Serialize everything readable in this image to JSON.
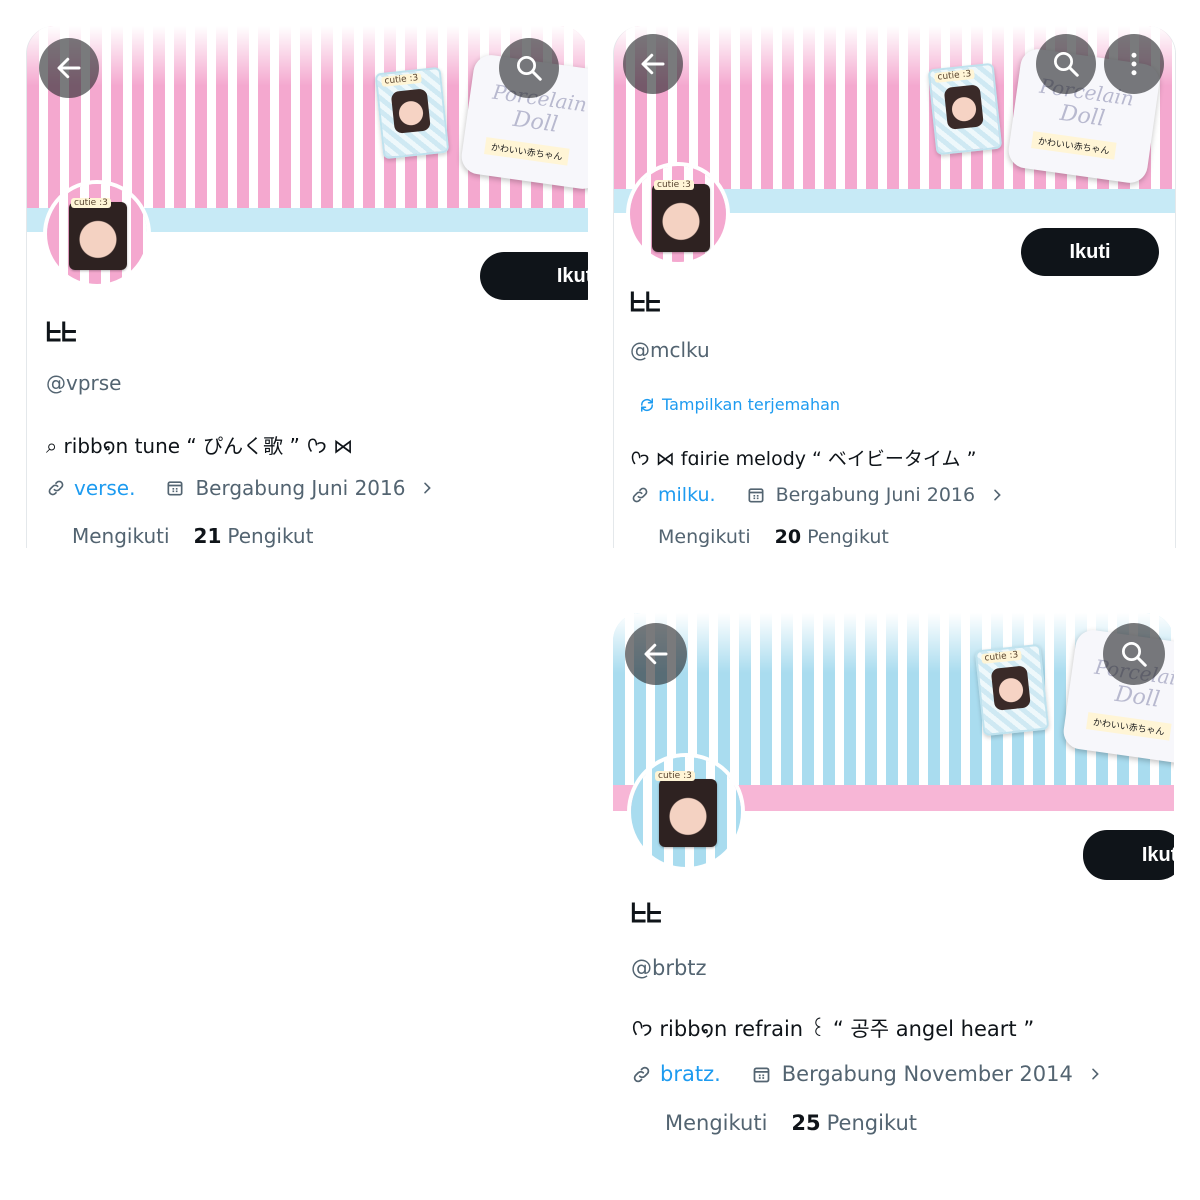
{
  "colors": {
    "accent": "#1d9bf0",
    "button_bg": "#0f1419",
    "muted": "#536471",
    "stripe_pink": "#f4a8cf",
    "stripe_blue": "#a9dcef"
  },
  "icons": {
    "back": "arrow-left-icon",
    "search": "search-icon",
    "more": "more-vertical-icon",
    "link": "link-icon",
    "calendar": "calendar-icon",
    "chevron": "chevron-right-icon",
    "translate": "translate-icon"
  },
  "banner_deco": {
    "photo_tag": "cutie :3",
    "card_line1": "Porcelain",
    "card_line2": "Doll",
    "card_tag": "かわいい赤ちゃん"
  },
  "profiles": [
    {
      "banner_theme": "pink-stripes",
      "display_name": "ᖶᖶ",
      "handle": "@vprse",
      "bio": "⌕ ribb໑n tune “ ぴんく歌 ” ᢉ𐭩 ⋈",
      "translate_label": "",
      "link": "verse.",
      "joined": "Bergabung Juni 2016",
      "following_label": "Mengikuti",
      "followers_count": "21",
      "followers_label": "Pengikut",
      "follow_label": "Ikuti"
    },
    {
      "banner_theme": "pink-stripes",
      "display_name": "ᖶᖶ",
      "handle": "@mclku",
      "bio": "ᢉ𐭩 ⋈ fɑirie melody “ ベイビータイム ”",
      "translate_label": "Tampilkan terjemahan",
      "link": "milku.",
      "joined": "Bergabung Juni 2016",
      "following_label": "Mengikuti",
      "followers_count": "20",
      "followers_label": "Pengikut",
      "follow_label": "Ikuti"
    },
    {
      "banner_theme": "blue-stripes",
      "display_name": "ᖶᖶ",
      "handle": "@brbtz",
      "bio": "ᢉ𐭩 ribb໑n refrain ꒰ “ 공주 angel heart ”",
      "translate_label": "",
      "link": "bratz.",
      "joined": "Bergabung November 2014",
      "following_label": "Mengikuti",
      "followers_count": "25",
      "followers_label": "Pengikut",
      "follow_label": "Ikuti"
    }
  ]
}
